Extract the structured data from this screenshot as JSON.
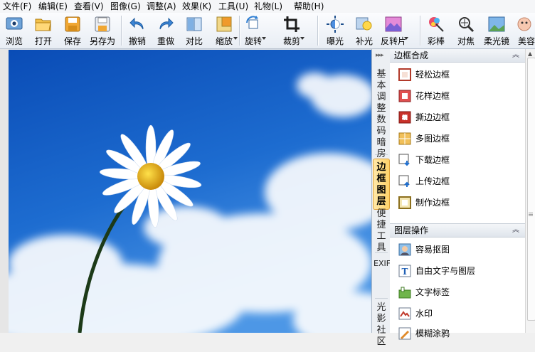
{
  "menu": [
    "文件(F)",
    "编辑(E)",
    "查看(V)",
    "图像(G)",
    "调整(A)",
    "效果(K)",
    "工具(U)",
    "礼物(L)",
    "帮助(H)"
  ],
  "toolbar": {
    "browse": "浏览",
    "open": "打开",
    "save": "保存",
    "save_as": "另存为",
    "undo": "撤销",
    "redo": "重做",
    "compare": "对比",
    "zoom": "缩放",
    "rotate": "旋转",
    "crop": "裁剪",
    "exposure": "曝光",
    "fill_light": "补光",
    "reverse": "反转片",
    "color_pen": "彩棒",
    "focus": "对焦",
    "soft_lens": "柔光镜",
    "beauty": "美容"
  },
  "side_tabs": {
    "basic": "基本调整",
    "darkroom": "数码暗房",
    "frame_layer": "边框图层",
    "tools": "便捷工具",
    "exif": "EXIF",
    "community": "光影社区"
  },
  "panel": {
    "frame_section": {
      "title": "边框合成",
      "items": [
        "轻松边框",
        "花样边框",
        "撕边边框",
        "多图边框",
        "下载边框",
        "上传边框",
        "制作边框"
      ]
    },
    "layer_section": {
      "title": "图层操作",
      "items": [
        "容易抠图",
        "自由文字与图层",
        "文字标签",
        "水印",
        "模糊涂鸦"
      ]
    }
  },
  "colors": {
    "sky_top": "#0c4fb8",
    "sky_bottom": "#3b8be0",
    "active_tab": "#ffd36a",
    "panel_header": "#e4e9ef"
  }
}
